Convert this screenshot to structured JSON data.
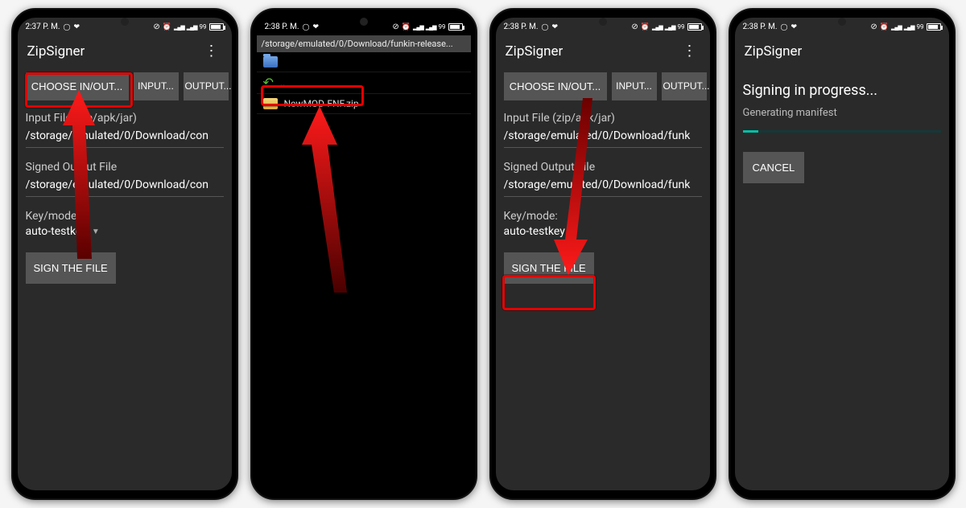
{
  "screens": [
    {
      "status": {
        "time": "2:37 P. M.",
        "battery": "99"
      },
      "appTitle": "ZipSigner",
      "buttons": {
        "choose": "CHOOSE IN/OUT...",
        "input": "INPUT...",
        "output": "OUTPUT..."
      },
      "inputLabel": "Input File (zip/apk/jar)",
      "inputValue": "/storage/emulated/0/Download/con",
      "outputLabel": "Signed Output File",
      "outputValue": "/storage/emulated/0/Download/con",
      "keyLabel": "Key/mode:",
      "keyValue": "auto-testkey",
      "signBtn": "SIGN THE FILE"
    },
    {
      "status": {
        "time": "2:38 P. M.",
        "battery": "99"
      },
      "path": "/storage/emulated/0/Download/funkin-release...",
      "upDir": "..",
      "file": "NewMOD-FNF.zip"
    },
    {
      "status": {
        "time": "2:38 P. M.",
        "battery": "99"
      },
      "appTitle": "ZipSigner",
      "buttons": {
        "choose": "CHOOSE IN/OUT...",
        "input": "INPUT...",
        "output": "OUTPUT..."
      },
      "inputLabel": "Input File (zip/apk/jar)",
      "inputValue": "/storage/emulated/0/Download/funk",
      "outputLabel": "Signed Output File",
      "outputValue": "/storage/emulated/0/Download/funk",
      "keyLabel": "Key/mode:",
      "keyValue": "auto-testkey",
      "signBtn": "SIGN THE FILE"
    },
    {
      "status": {
        "time": "2:38 P. M.",
        "battery": "99"
      },
      "appTitle": "ZipSigner",
      "progressTitle": "Signing in progress...",
      "progressSub": "Generating manifest",
      "cancelBtn": "CANCEL"
    }
  ]
}
